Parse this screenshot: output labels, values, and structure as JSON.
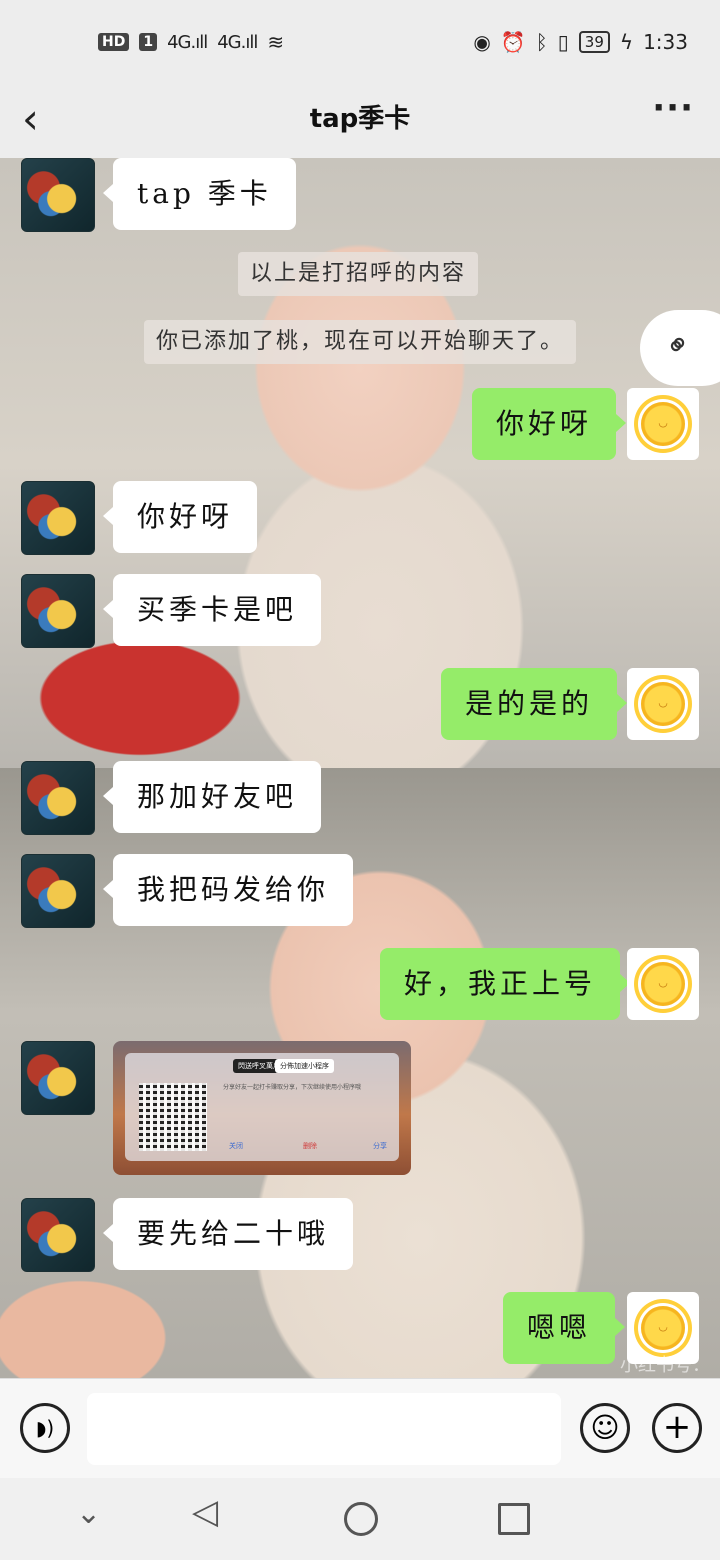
{
  "status_bar": {
    "hd": "HD",
    "sim": "1",
    "signal1": "4G.ıll",
    "signal2": "4G.ıll",
    "wifi_icon": "wifi-icon",
    "eye_icon": "eye-icon",
    "alarm_icon": "alarm-off-icon",
    "bluetooth_icon": "bluetooth-icon",
    "vibrate_icon": "vibrate-icon",
    "battery": "39",
    "charging_icon": "charging-icon",
    "time": "1:33"
  },
  "header": {
    "back_icon": "‹",
    "title": "tap季卡",
    "more_icon": "···"
  },
  "messages": [
    {
      "side": "left",
      "text": "tap 季卡"
    },
    {
      "side": "system",
      "text": "以上是打招呼的内容"
    },
    {
      "side": "system",
      "text": "你已添加了桃，现在可以开始聊天了。"
    },
    {
      "side": "right",
      "text": "你好呀"
    },
    {
      "side": "left",
      "text": "你好呀"
    },
    {
      "side": "left",
      "text": "买季卡是吧"
    },
    {
      "side": "right",
      "text": "是的是的"
    },
    {
      "side": "left",
      "text": "那加好友吧"
    },
    {
      "side": "left",
      "text": "我把码发给你"
    },
    {
      "side": "right",
      "text": "好，我正上号"
    },
    {
      "side": "left",
      "type": "image",
      "text": ""
    },
    {
      "side": "left",
      "text": "要先给二十哦"
    },
    {
      "side": "right",
      "text": "嗯嗯"
    }
  ],
  "qr_card": {
    "tag1": "閃送呼叉萬戶",
    "tag2": "分佈加速小程序",
    "desc": "分享好友一起打卡赚取分享，下次继续使用小程序哦",
    "btn_close": "关闭",
    "btn_delete": "删除",
    "btn_share": "分享"
  },
  "watermark": "小红书号：",
  "input_bar": {
    "voice_icon": "voice-icon",
    "emoji_icon": "emoji-icon",
    "plus_icon": "plus-icon"
  },
  "nav_bar": {
    "down_icon": "chevron-down-icon",
    "back_icon": "triangle-back-icon",
    "home_icon": "circle-home-icon",
    "recent_icon": "square-recent-icon"
  }
}
